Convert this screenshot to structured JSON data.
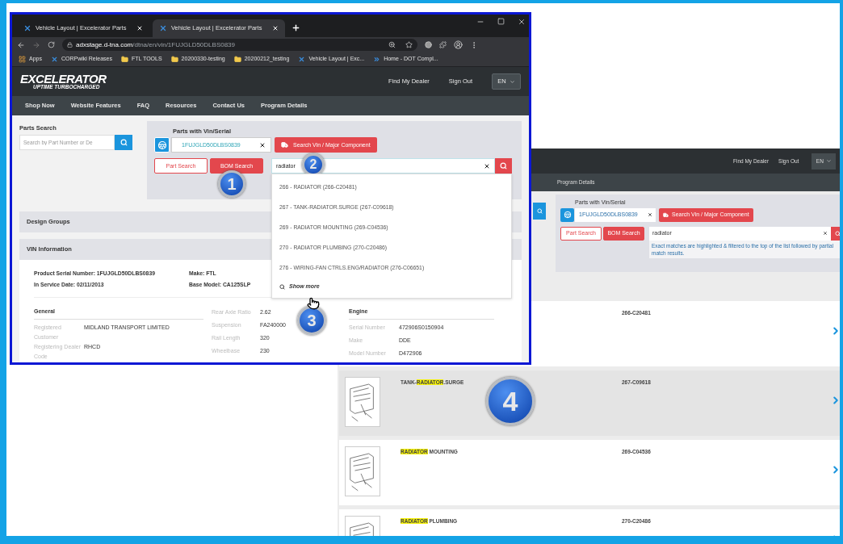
{
  "front_window": {
    "tabs": [
      {
        "title": "Vehicle Layout | Excelerator Parts",
        "selected": false
      },
      {
        "title": "Vehicle Layout | Excelerator Parts",
        "selected": true
      }
    ],
    "address": {
      "domain": "adxstage.d-tna.com",
      "path": "/dtna/en/vin/1FUJGLD50DLBS0839"
    },
    "bookmarks": [
      {
        "label": "Apps",
        "kind": "apps"
      },
      {
        "label": "CORPwiki Releases",
        "kind": "site"
      },
      {
        "label": "FTL TOOLS",
        "kind": "folder"
      },
      {
        "label": "20200330-testing",
        "kind": "folder"
      },
      {
        "label": "20200212_testing",
        "kind": "folder"
      },
      {
        "label": "Vehicle Layout | Exc...",
        "kind": "site"
      },
      {
        "label": "Home - DOT Compl...",
        "kind": "link"
      }
    ],
    "logo": {
      "title": "EXCELERATOR",
      "tagline": "UPTIME TURBOCHARGED"
    },
    "header_links": [
      "Find My Dealer",
      "Sign Out"
    ],
    "language": "EN",
    "nav": [
      "Shop Now",
      "Website Features",
      "FAQ",
      "Resources",
      "Contact Us",
      "Program Details"
    ],
    "parts_search": {
      "label": "Parts Search",
      "placeholder": "Search by Part Number or De"
    },
    "vin_panel": {
      "label": "Parts with Vin/Serial",
      "vin": "1FUJGLD50DLBS0839",
      "search_button": "Search Vin / Major Component",
      "modes": [
        {
          "label": "Part Search",
          "selected": false
        },
        {
          "label": "BOM Search",
          "selected": true
        }
      ],
      "query": "radiator"
    },
    "suggestions": [
      "266 - RADIATOR (266-C20481)",
      "267 - TANK-RADIATOR.SURGE (267-C09618)",
      "269 - RADIATOR MOUNTING (269-C04536)",
      "270 - RADIATOR PLUMBING (270-C20486)",
      "276 - WIRING-FAN CTRLS.ENG/RADIATOR (276-C06651)"
    ],
    "show_more": "Show more",
    "sections": [
      "Design Groups",
      "VIN Information"
    ],
    "vin_info": {
      "summary": [
        {
          "label": "Product Serial Number:",
          "value": "1FUJGLD50DLBS0839"
        },
        {
          "label": "Make:",
          "value": "FTL"
        },
        {
          "label": "In Service Date:",
          "value": "02/11/2013"
        },
        {
          "label": "Base Model:",
          "value": "CA125SLP"
        }
      ],
      "columns": [
        {
          "title": "General",
          "fields": [
            {
              "label": "Registered Customer",
              "value": "MIDLAND TRANSPORT LIMITED"
            },
            {
              "label": "Registering Dealer Code",
              "value": "RHCD"
            }
          ]
        },
        {
          "fields": [
            {
              "label": "Rear Axle Ratio",
              "value": "2.62"
            },
            {
              "label": "Suspension",
              "value": "FA240000"
            },
            {
              "label": "Rail Length",
              "value": "320"
            },
            {
              "label": "Wheelbase",
              "value": "230"
            }
          ]
        },
        {
          "title": "Engine",
          "fields": [
            {
              "label": "Serial Number",
              "value": "472906S0150904"
            },
            {
              "label": "Make",
              "value": "DDE"
            },
            {
              "label": "Model Number",
              "value": "D472906"
            }
          ]
        }
      ]
    }
  },
  "back_window": {
    "header_links": [
      "Find My Dealer",
      "Sign Out"
    ],
    "language": "EN",
    "nav": [
      "Program Details"
    ],
    "vin_panel": {
      "label": "Parts with Vin/Serial",
      "vin": "1FUJGLD50DLBS0839",
      "search_button": "Search Vin / Major Component",
      "modes": [
        {
          "label": "Part Search",
          "selected": false
        },
        {
          "label": "BOM Search",
          "selected": true
        }
      ],
      "query": "radiator",
      "hint": "Exact matches are highlighted & filtered to the top of the list followed by partial match results."
    },
    "results": [
      {
        "code": "266-C20481",
        "selected": false
      },
      {
        "name_parts": [
          {
            "text": "TANK-",
            "highlighted": false
          },
          {
            "text": "RADIATOR",
            "highlighted": true
          },
          {
            "text": ".SURGE",
            "highlighted": false
          }
        ],
        "code": "267-C09618",
        "thumbnail": true,
        "selected": true
      },
      {
        "name_parts": [
          {
            "text": "RADIATOR",
            "highlighted": true
          },
          {
            "text": " MOUNTING",
            "highlighted": false
          }
        ],
        "code": "269-C04536",
        "thumbnail": true,
        "selected": false
      },
      {
        "name_parts": [
          {
            "text": "RADIATOR",
            "highlighted": true
          },
          {
            "text": " PLUMBING",
            "highlighted": false
          }
        ],
        "code": "270-C20486",
        "thumbnail": true,
        "selected": false
      }
    ]
  },
  "callouts": [
    "1",
    "2",
    "3",
    "4"
  ]
}
